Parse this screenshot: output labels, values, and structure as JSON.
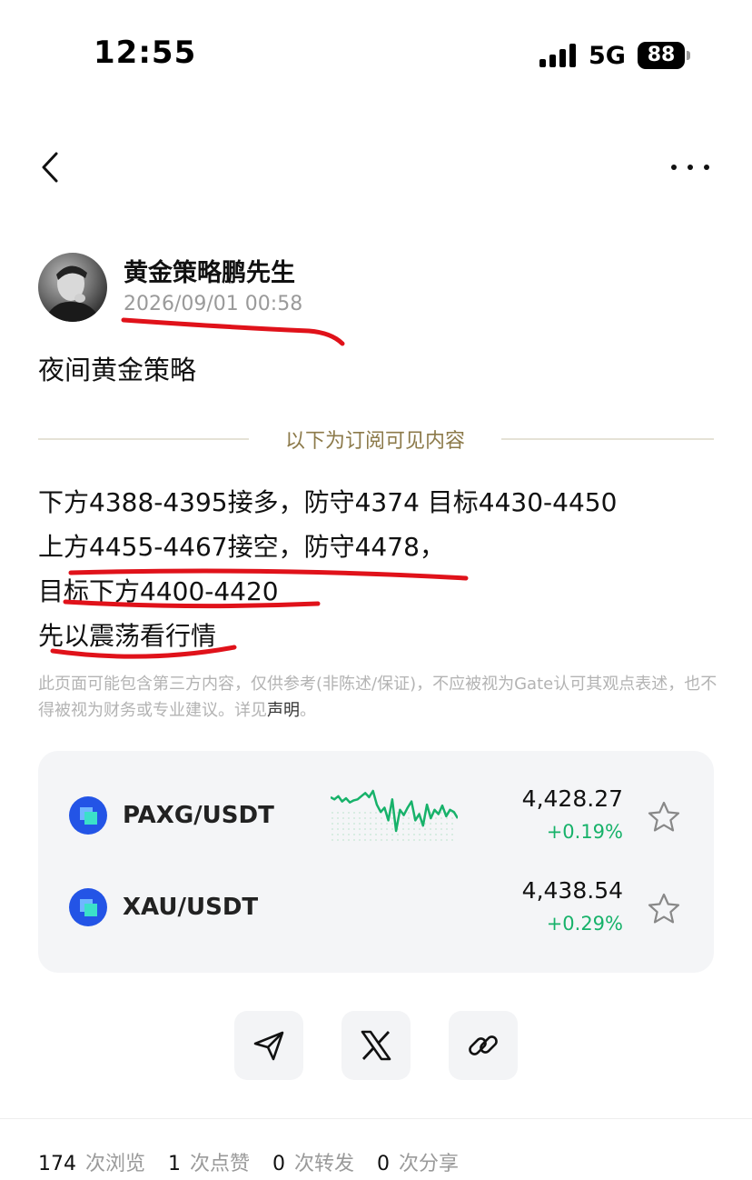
{
  "status_bar": {
    "time": "12:55",
    "network": "5G",
    "battery": "88"
  },
  "post": {
    "author": "黄金策略鹏先生",
    "date": "2026/09/01 00:58",
    "title": "夜间黄金策略",
    "subscriber_divider": "以下为订阅可见内容",
    "body_lines": [
      "下方4388-4395接多，防守4374 目标4430-4450",
      "上方4455-4467接空，防守4478，",
      "目标下方4400-4420",
      "先以震荡看行情"
    ],
    "disclaimer": "此页面可能包含第三方内容，仅供参考(非陈述/保证)，不应被视为Gate认可其观点表述，也不得被视为财务或专业建议。详见",
    "disclaimer_link": "声明",
    "disclaimer_end": "。"
  },
  "tickers": [
    {
      "pair": "PAXG/USDT",
      "price": "4,428.27",
      "change": "+0.19%"
    },
    {
      "pair": "XAU/USDT",
      "price": "4,438.54",
      "change": "+0.29%"
    }
  ],
  "sparkline": [
    62,
    60,
    63,
    58,
    61,
    57,
    59,
    60,
    63,
    66,
    62,
    68,
    55,
    48,
    52,
    40,
    60,
    30,
    50,
    45,
    52,
    58,
    40,
    46,
    35,
    55,
    42,
    50,
    46,
    54,
    44,
    50,
    48,
    42
  ],
  "stats": [
    {
      "count": "174",
      "label": "次浏览"
    },
    {
      "count": "1",
      "label": "次点赞"
    },
    {
      "count": "0",
      "label": "次转发"
    },
    {
      "count": "0",
      "label": "次分享"
    }
  ],
  "colors": {
    "accent_green": "#17b26a",
    "coin_blue": "#2354e6",
    "divider_gold": "#8c7a4a",
    "annotation_red": "#e0121a"
  },
  "icons": [
    "back-chevron-icon",
    "more-dots-icon",
    "coin-logo-icon",
    "star-icon",
    "send-icon",
    "x-logo-icon",
    "link-icon"
  ]
}
